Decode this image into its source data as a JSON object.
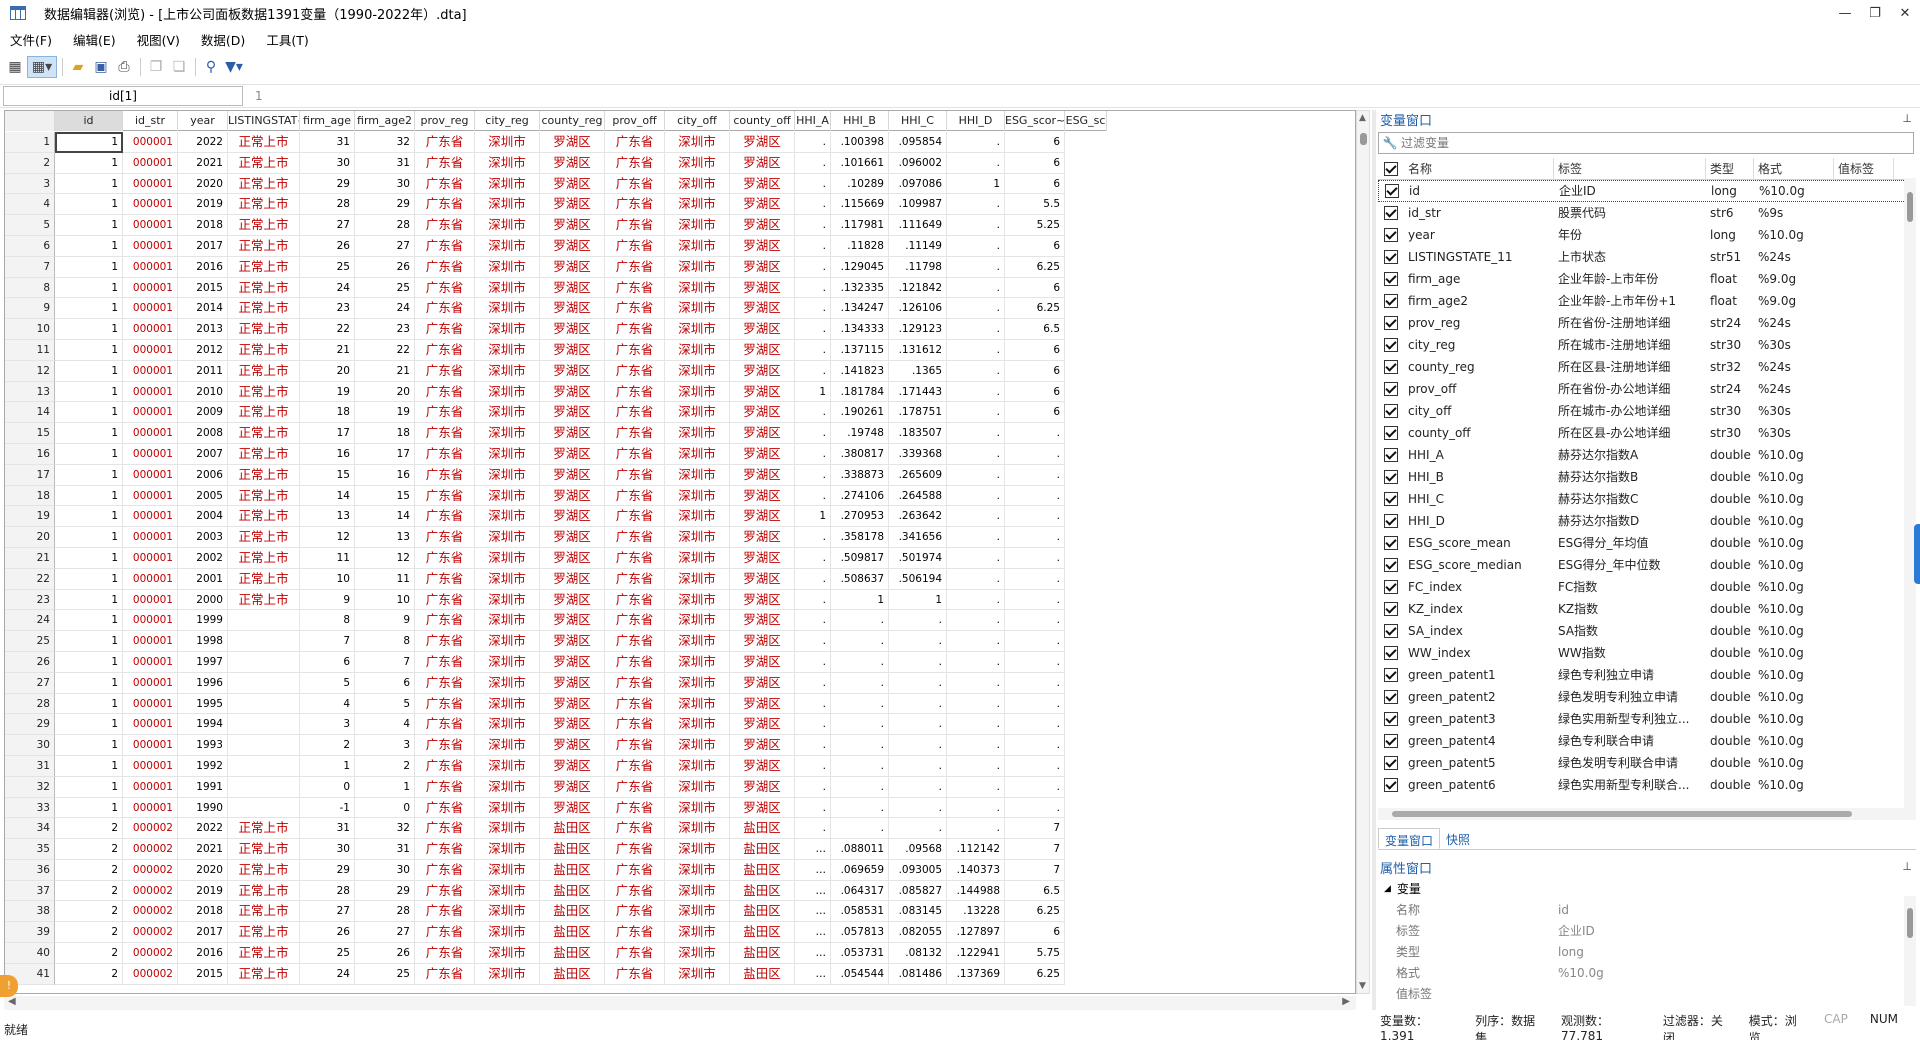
{
  "window": {
    "title": "数据编辑器(浏览) - [上市公司面板数据1391变量（1990-2022年）.dta]",
    "minimize": "—",
    "restore": "❐",
    "close": "✕"
  },
  "menu": [
    "文件(F)",
    "编辑(E)",
    "视图(V)",
    "数据(D)",
    "工具(T)"
  ],
  "toolbar_icons": [
    "grid-icon",
    "grid-view-icon",
    "open-folder-icon",
    "save-icon",
    "print-icon",
    "copy-icon",
    "paste-icon",
    "search-icon",
    "filter-icon"
  ],
  "editbar": {
    "varname": "id[1]",
    "value": "1"
  },
  "grid": {
    "columns": [
      "id",
      "id_str",
      "year",
      "LISTINGSTAT~11",
      "firm_age",
      "firm_age2",
      "prov_reg",
      "city_reg",
      "county_reg",
      "prov_off",
      "city_off",
      "county_off",
      "HHI_A",
      "HHI_B",
      "HHI_C",
      "HHI_D",
      "ESG_scor~ean",
      "ESG_sc"
    ],
    "rows": [
      [
        "1",
        "1",
        "000001",
        "2022",
        "正常上市",
        "31",
        "32",
        "广东省",
        "深圳市",
        "罗湖区",
        "广东省",
        "深圳市",
        "罗湖区",
        ".",
        ".100398",
        ".095854",
        ".",
        "6"
      ],
      [
        "2",
        "1",
        "000001",
        "2021",
        "正常上市",
        "30",
        "31",
        "广东省",
        "深圳市",
        "罗湖区",
        "广东省",
        "深圳市",
        "罗湖区",
        ".",
        ".101661",
        ".096002",
        ".",
        "6"
      ],
      [
        "3",
        "1",
        "000001",
        "2020",
        "正常上市",
        "29",
        "30",
        "广东省",
        "深圳市",
        "罗湖区",
        "广东省",
        "深圳市",
        "罗湖区",
        ".",
        ".10289",
        ".097086",
        "1",
        "6"
      ],
      [
        "4",
        "1",
        "000001",
        "2019",
        "正常上市",
        "28",
        "29",
        "广东省",
        "深圳市",
        "罗湖区",
        "广东省",
        "深圳市",
        "罗湖区",
        ".",
        ".115669",
        ".109987",
        ".",
        "5.5"
      ],
      [
        "5",
        "1",
        "000001",
        "2018",
        "正常上市",
        "27",
        "28",
        "广东省",
        "深圳市",
        "罗湖区",
        "广东省",
        "深圳市",
        "罗湖区",
        ".",
        ".117981",
        ".111649",
        ".",
        "5.25"
      ],
      [
        "6",
        "1",
        "000001",
        "2017",
        "正常上市",
        "26",
        "27",
        "广东省",
        "深圳市",
        "罗湖区",
        "广东省",
        "深圳市",
        "罗湖区",
        ".",
        ".11828",
        ".11149",
        ".",
        "6"
      ],
      [
        "7",
        "1",
        "000001",
        "2016",
        "正常上市",
        "25",
        "26",
        "广东省",
        "深圳市",
        "罗湖区",
        "广东省",
        "深圳市",
        "罗湖区",
        ".",
        ".129045",
        ".11798",
        ".",
        "6.25"
      ],
      [
        "8",
        "1",
        "000001",
        "2015",
        "正常上市",
        "24",
        "25",
        "广东省",
        "深圳市",
        "罗湖区",
        "广东省",
        "深圳市",
        "罗湖区",
        ".",
        ".132335",
        ".121842",
        ".",
        "6"
      ],
      [
        "9",
        "1",
        "000001",
        "2014",
        "正常上市",
        "23",
        "24",
        "广东省",
        "深圳市",
        "罗湖区",
        "广东省",
        "深圳市",
        "罗湖区",
        ".",
        ".134247",
        ".126106",
        ".",
        "6.25"
      ],
      [
        "10",
        "1",
        "000001",
        "2013",
        "正常上市",
        "22",
        "23",
        "广东省",
        "深圳市",
        "罗湖区",
        "广东省",
        "深圳市",
        "罗湖区",
        ".",
        ".134333",
        ".129123",
        ".",
        "6.5"
      ],
      [
        "11",
        "1",
        "000001",
        "2012",
        "正常上市",
        "21",
        "22",
        "广东省",
        "深圳市",
        "罗湖区",
        "广东省",
        "深圳市",
        "罗湖区",
        ".",
        ".137115",
        ".131612",
        ".",
        "6"
      ],
      [
        "12",
        "1",
        "000001",
        "2011",
        "正常上市",
        "20",
        "21",
        "广东省",
        "深圳市",
        "罗湖区",
        "广东省",
        "深圳市",
        "罗湖区",
        ".",
        ".141823",
        ".1365",
        ".",
        "6"
      ],
      [
        "13",
        "1",
        "000001",
        "2010",
        "正常上市",
        "19",
        "20",
        "广东省",
        "深圳市",
        "罗湖区",
        "广东省",
        "深圳市",
        "罗湖区",
        "1",
        ".181784",
        ".171443",
        ".",
        "6"
      ],
      [
        "14",
        "1",
        "000001",
        "2009",
        "正常上市",
        "18",
        "19",
        "广东省",
        "深圳市",
        "罗湖区",
        "广东省",
        "深圳市",
        "罗湖区",
        ".",
        ".190261",
        ".178751",
        ".",
        "6"
      ],
      [
        "15",
        "1",
        "000001",
        "2008",
        "正常上市",
        "17",
        "18",
        "广东省",
        "深圳市",
        "罗湖区",
        "广东省",
        "深圳市",
        "罗湖区",
        ".",
        ".19748",
        ".183507",
        ".",
        "."
      ],
      [
        "16",
        "1",
        "000001",
        "2007",
        "正常上市",
        "16",
        "17",
        "广东省",
        "深圳市",
        "罗湖区",
        "广东省",
        "深圳市",
        "罗湖区",
        ".",
        ".380817",
        ".339368",
        ".",
        "."
      ],
      [
        "17",
        "1",
        "000001",
        "2006",
        "正常上市",
        "15",
        "16",
        "广东省",
        "深圳市",
        "罗湖区",
        "广东省",
        "深圳市",
        "罗湖区",
        ".",
        ".338873",
        ".265609",
        ".",
        "."
      ],
      [
        "18",
        "1",
        "000001",
        "2005",
        "正常上市",
        "14",
        "15",
        "广东省",
        "深圳市",
        "罗湖区",
        "广东省",
        "深圳市",
        "罗湖区",
        ".",
        ".274106",
        ".264588",
        ".",
        "."
      ],
      [
        "19",
        "1",
        "000001",
        "2004",
        "正常上市",
        "13",
        "14",
        "广东省",
        "深圳市",
        "罗湖区",
        "广东省",
        "深圳市",
        "罗湖区",
        "1",
        ".270953",
        ".263642",
        ".",
        "."
      ],
      [
        "20",
        "1",
        "000001",
        "2003",
        "正常上市",
        "12",
        "13",
        "广东省",
        "深圳市",
        "罗湖区",
        "广东省",
        "深圳市",
        "罗湖区",
        ".",
        ".358178",
        ".341656",
        ".",
        "."
      ],
      [
        "21",
        "1",
        "000001",
        "2002",
        "正常上市",
        "11",
        "12",
        "广东省",
        "深圳市",
        "罗湖区",
        "广东省",
        "深圳市",
        "罗湖区",
        ".",
        ".509817",
        ".501974",
        ".",
        "."
      ],
      [
        "22",
        "1",
        "000001",
        "2001",
        "正常上市",
        "10",
        "11",
        "广东省",
        "深圳市",
        "罗湖区",
        "广东省",
        "深圳市",
        "罗湖区",
        ".",
        ".508637",
        ".506194",
        ".",
        "."
      ],
      [
        "23",
        "1",
        "000001",
        "2000",
        "正常上市",
        "9",
        "10",
        "广东省",
        "深圳市",
        "罗湖区",
        "广东省",
        "深圳市",
        "罗湖区",
        ".",
        "1",
        "1",
        ".",
        "."
      ],
      [
        "24",
        "1",
        "000001",
        "1999",
        "",
        "8",
        "9",
        "广东省",
        "深圳市",
        "罗湖区",
        "广东省",
        "深圳市",
        "罗湖区",
        ".",
        ".",
        ".",
        ".",
        "."
      ],
      [
        "25",
        "1",
        "000001",
        "1998",
        "",
        "7",
        "8",
        "广东省",
        "深圳市",
        "罗湖区",
        "广东省",
        "深圳市",
        "罗湖区",
        ".",
        ".",
        ".",
        ".",
        "."
      ],
      [
        "26",
        "1",
        "000001",
        "1997",
        "",
        "6",
        "7",
        "广东省",
        "深圳市",
        "罗湖区",
        "广东省",
        "深圳市",
        "罗湖区",
        ".",
        ".",
        ".",
        ".",
        "."
      ],
      [
        "27",
        "1",
        "000001",
        "1996",
        "",
        "5",
        "6",
        "广东省",
        "深圳市",
        "罗湖区",
        "广东省",
        "深圳市",
        "罗湖区",
        ".",
        ".",
        ".",
        ".",
        "."
      ],
      [
        "28",
        "1",
        "000001",
        "1995",
        "",
        "4",
        "5",
        "广东省",
        "深圳市",
        "罗湖区",
        "广东省",
        "深圳市",
        "罗湖区",
        ".",
        ".",
        ".",
        ".",
        "."
      ],
      [
        "29",
        "1",
        "000001",
        "1994",
        "",
        "3",
        "4",
        "广东省",
        "深圳市",
        "罗湖区",
        "广东省",
        "深圳市",
        "罗湖区",
        ".",
        ".",
        ".",
        ".",
        "."
      ],
      [
        "30",
        "1",
        "000001",
        "1993",
        "",
        "2",
        "3",
        "广东省",
        "深圳市",
        "罗湖区",
        "广东省",
        "深圳市",
        "罗湖区",
        ".",
        ".",
        ".",
        ".",
        "."
      ],
      [
        "31",
        "1",
        "000001",
        "1992",
        "",
        "1",
        "2",
        "广东省",
        "深圳市",
        "罗湖区",
        "广东省",
        "深圳市",
        "罗湖区",
        ".",
        ".",
        ".",
        ".",
        "."
      ],
      [
        "32",
        "1",
        "000001",
        "1991",
        "",
        "0",
        "1",
        "广东省",
        "深圳市",
        "罗湖区",
        "广东省",
        "深圳市",
        "罗湖区",
        ".",
        ".",
        ".",
        ".",
        "."
      ],
      [
        "33",
        "1",
        "000001",
        "1990",
        "",
        "-1",
        "0",
        "广东省",
        "深圳市",
        "罗湖区",
        "广东省",
        "深圳市",
        "罗湖区",
        ".",
        ".",
        ".",
        ".",
        "."
      ],
      [
        "34",
        "2",
        "000002",
        "2022",
        "正常上市",
        "31",
        "32",
        "广东省",
        "深圳市",
        "盐田区",
        "广东省",
        "深圳市",
        "盐田区",
        ".",
        ".",
        ".",
        ".",
        "7"
      ],
      [
        "35",
        "2",
        "000002",
        "2021",
        "正常上市",
        "30",
        "31",
        "广东省",
        "深圳市",
        "盐田区",
        "广东省",
        "深圳市",
        "盐田区",
        "…",
        ".088011",
        ".09568",
        ".112142",
        "7"
      ],
      [
        "36",
        "2",
        "000002",
        "2020",
        "正常上市",
        "29",
        "30",
        "广东省",
        "深圳市",
        "盐田区",
        "广东省",
        "深圳市",
        "盐田区",
        "…",
        ".069659",
        ".093005",
        ".140373",
        "7"
      ],
      [
        "37",
        "2",
        "000002",
        "2019",
        "正常上市",
        "28",
        "29",
        "广东省",
        "深圳市",
        "盐田区",
        "广东省",
        "深圳市",
        "盐田区",
        "…",
        ".064317",
        ".085827",
        ".144988",
        "6.5"
      ],
      [
        "38",
        "2",
        "000002",
        "2018",
        "正常上市",
        "27",
        "28",
        "广东省",
        "深圳市",
        "盐田区",
        "广东省",
        "深圳市",
        "盐田区",
        "…",
        ".058531",
        ".083145",
        ".13228",
        "6.25"
      ],
      [
        "39",
        "2",
        "000002",
        "2017",
        "正常上市",
        "26",
        "27",
        "广东省",
        "深圳市",
        "盐田区",
        "广东省",
        "深圳市",
        "盐田区",
        "…",
        ".057813",
        ".082055",
        ".127897",
        "6"
      ],
      [
        "40",
        "2",
        "000002",
        "2016",
        "正常上市",
        "25",
        "26",
        "广东省",
        "深圳市",
        "盐田区",
        "广东省",
        "深圳市",
        "盐田区",
        "…",
        ".053731",
        ".08132",
        ".122941",
        "5.75"
      ],
      [
        "41",
        "2",
        "000002",
        "2015",
        "正常上市",
        "24",
        "25",
        "广东省",
        "深圳市",
        "盐田区",
        "广东省",
        "深圳市",
        "盐田区",
        "…",
        ".054544",
        ".081486",
        ".137369",
        "6.25"
      ]
    ]
  },
  "varpane": {
    "title": "变量窗口",
    "pin": "⊥",
    "filter_placeholder": "过滤变量",
    "headers": [
      "名称",
      "标签",
      "类型",
      "格式",
      "值标签"
    ],
    "vars": [
      [
        "id",
        "企业ID",
        "long",
        "%10.0g"
      ],
      [
        "id_str",
        "股票代码",
        "str6",
        "%9s"
      ],
      [
        "year",
        "年份",
        "long",
        "%10.0g"
      ],
      [
        "LISTINGSTATE_11",
        "上市状态",
        "str51",
        "%24s"
      ],
      [
        "firm_age",
        "企业年龄-上市年份",
        "float",
        "%9.0g"
      ],
      [
        "firm_age2",
        "企业年龄-上市年份+1",
        "float",
        "%9.0g"
      ],
      [
        "prov_reg",
        "所在省份-注册地详细",
        "str24",
        "%24s"
      ],
      [
        "city_reg",
        "所在城市-注册地详细",
        "str30",
        "%30s"
      ],
      [
        "county_reg",
        "所在区县-注册地详细",
        "str32",
        "%24s"
      ],
      [
        "prov_off",
        "所在省份-办公地详细",
        "str24",
        "%24s"
      ],
      [
        "city_off",
        "所在城市-办公地详细",
        "str30",
        "%30s"
      ],
      [
        "county_off",
        "所在区县-办公地详细",
        "str30",
        "%30s"
      ],
      [
        "HHI_A",
        "赫芬达尔指数A",
        "double",
        "%10.0g"
      ],
      [
        "HHI_B",
        "赫芬达尔指数B",
        "double",
        "%10.0g"
      ],
      [
        "HHI_C",
        "赫芬达尔指数C",
        "double",
        "%10.0g"
      ],
      [
        "HHI_D",
        "赫芬达尔指数D",
        "double",
        "%10.0g"
      ],
      [
        "ESG_score_mean",
        "ESG得分_年均值",
        "double",
        "%10.0g"
      ],
      [
        "ESG_score_median",
        "ESG得分_年中位数",
        "double",
        "%10.0g"
      ],
      [
        "FC_index",
        "FC指数",
        "double",
        "%10.0g"
      ],
      [
        "KZ_index",
        "KZ指数",
        "double",
        "%10.0g"
      ],
      [
        "SA_index",
        "SA指数",
        "double",
        "%10.0g"
      ],
      [
        "WW_index",
        "WW指数",
        "double",
        "%10.0g"
      ],
      [
        "green_patent1",
        "绿色专利独立申请",
        "double",
        "%10.0g"
      ],
      [
        "green_patent2",
        "绿色发明专利独立申请",
        "double",
        "%10.0g"
      ],
      [
        "green_patent3",
        "绿色实用新型专利独立...",
        "double",
        "%10.0g"
      ],
      [
        "green_patent4",
        "绿色专利联合申请",
        "double",
        "%10.0g"
      ],
      [
        "green_patent5",
        "绿色发明专利联合申请",
        "double",
        "%10.0g"
      ],
      [
        "green_patent6",
        "绿色实用新型专利联合...",
        "double",
        "%10.0g"
      ]
    ]
  },
  "var_tabs": [
    "变量窗口",
    "快照"
  ],
  "proppane": {
    "title": "属性窗口",
    "pin": "⊥",
    "group": "变量",
    "fields": [
      {
        "k": "名称",
        "v": "id"
      },
      {
        "k": "标签",
        "v": "企业ID"
      },
      {
        "k": "类型",
        "v": "long"
      },
      {
        "k": "格式",
        "v": "%10.0g"
      },
      {
        "k": "值标签",
        "v": ""
      }
    ]
  },
  "status": {
    "ready": "就绪",
    "vars": "变量数：1,391",
    "order": "列序：数据集",
    "obs": "观测数：77,781",
    "filter": "过滤器：关闭",
    "mode": "模式：浏览",
    "cap": "CAP",
    "num": "NUM"
  }
}
